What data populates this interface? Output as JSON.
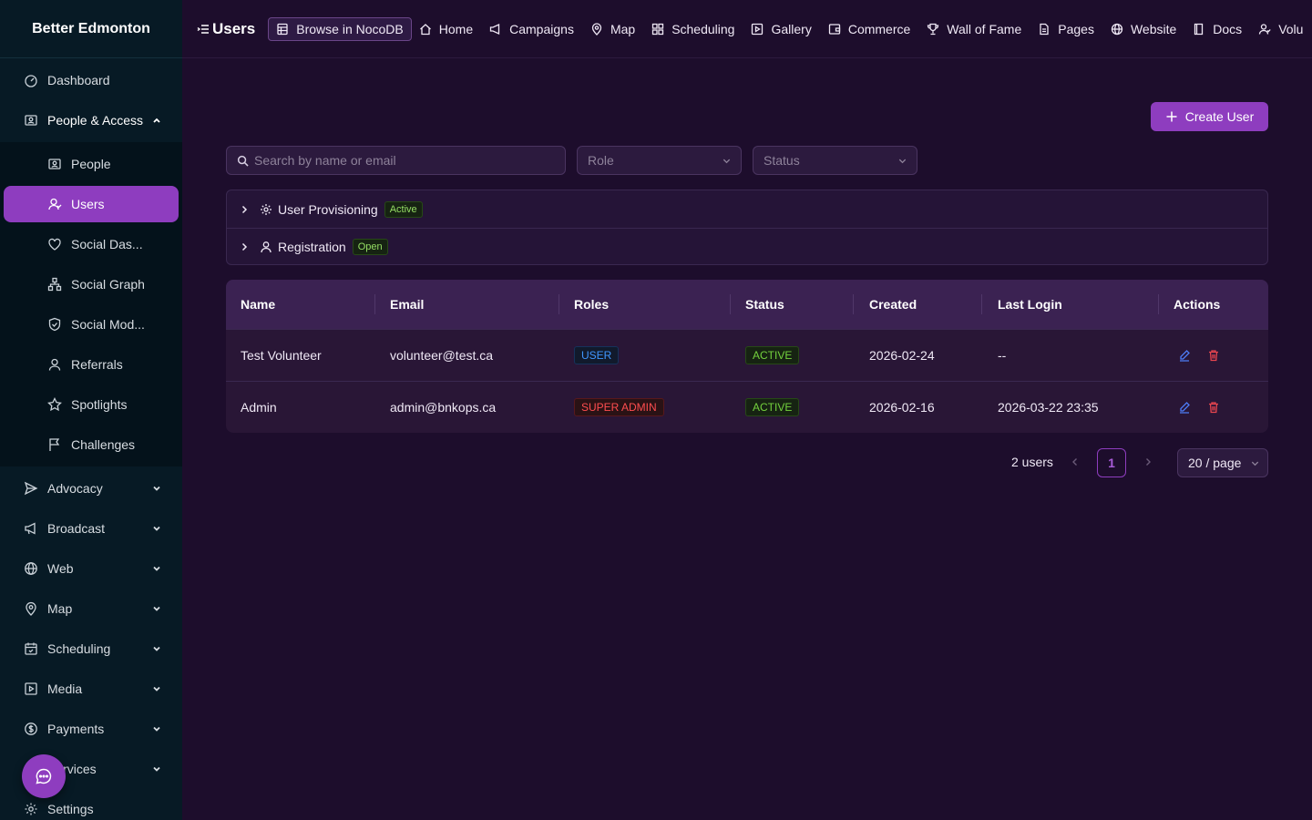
{
  "brand": "Better Edmonton",
  "sidebar": {
    "items": [
      {
        "label": "Dashboard",
        "icon": "dashboard-icon"
      },
      {
        "label": "People & Access",
        "icon": "id-card-icon",
        "expanded": true
      },
      {
        "label": "People",
        "icon": "id-card-icon"
      },
      {
        "label": "Users",
        "icon": "user-icon",
        "active": true
      },
      {
        "label": "Social Das...",
        "icon": "heart-icon"
      },
      {
        "label": "Social Graph",
        "icon": "graph-icon"
      },
      {
        "label": "Social Mod...",
        "icon": "shield-check-icon"
      },
      {
        "label": "Referrals",
        "icon": "user-icon"
      },
      {
        "label": "Spotlights",
        "icon": "star-icon"
      },
      {
        "label": "Challenges",
        "icon": "flag-icon"
      },
      {
        "label": "Advocacy",
        "icon": "send-icon"
      },
      {
        "label": "Broadcast",
        "icon": "megaphone-icon"
      },
      {
        "label": "Web",
        "icon": "globe-icon"
      },
      {
        "label": "Map",
        "icon": "pin-icon"
      },
      {
        "label": "Scheduling",
        "icon": "calendar-icon"
      },
      {
        "label": "Media",
        "icon": "play-square-icon"
      },
      {
        "label": "Payments",
        "icon": "dollar-icon"
      },
      {
        "label": "Services",
        "icon": "cloud-icon"
      },
      {
        "label": "Settings",
        "icon": "gear-icon"
      }
    ]
  },
  "topbar": {
    "title": "Users",
    "browse_label": "Browse in NocoDB",
    "links": [
      "Home",
      "Campaigns",
      "Map",
      "Scheduling",
      "Gallery",
      "Commerce",
      "Wall of Fame",
      "Pages",
      "Website",
      "Docs",
      "Volu"
    ]
  },
  "main": {
    "create_label": "Create User",
    "search_placeholder": "Search by name or email",
    "role_placeholder": "Role",
    "status_placeholder": "Status",
    "panels": [
      {
        "label": "User Provisioning",
        "tag": "Active"
      },
      {
        "label": "Registration",
        "tag": "Open"
      }
    ],
    "table": {
      "columns": [
        "Name",
        "Email",
        "Roles",
        "Status",
        "Created",
        "Last Login",
        "Actions"
      ],
      "rows": [
        {
          "name": "Test Volunteer",
          "email": "volunteer@test.ca",
          "role": "USER",
          "status": "ACTIVE",
          "created": "2026-02-24",
          "last_login": "--"
        },
        {
          "name": "Admin",
          "email": "admin@bnkops.ca",
          "role": "SUPER ADMIN",
          "status": "ACTIVE",
          "created": "2026-02-16",
          "last_login": "2026-03-22 23:35"
        }
      ]
    },
    "pagination": {
      "total": "2 users",
      "current": "1",
      "page_size": "20 / page"
    }
  },
  "colors": {
    "accent": "#8e3dbf",
    "sidebar_bg": "#071a25",
    "main_bg": "#1d0d2c"
  }
}
